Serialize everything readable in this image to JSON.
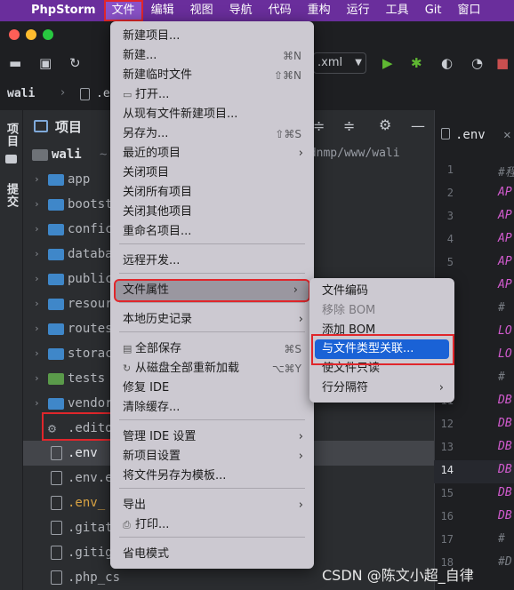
{
  "menubar": {
    "app": "PhpStorm",
    "items": [
      "文件",
      "编辑",
      "视图",
      "导航",
      "代码",
      "重构",
      "运行",
      "工具",
      "Git",
      "窗口"
    ]
  },
  "toolbar": {
    "run_config": ".xml"
  },
  "breadcrumb": {
    "project": "wali",
    "file": ".e"
  },
  "side_strip": {
    "project": "项目",
    "commit": "提交"
  },
  "project_panel": {
    "title": "项目",
    "root": "wali",
    "root_suffix": "~",
    "path": "/dnmp/www/wali",
    "rows": [
      {
        "label": "app",
        "kind": "folder"
      },
      {
        "label": "bootst",
        "kind": "folder"
      },
      {
        "label": "confic",
        "kind": "folder"
      },
      {
        "label": "databa",
        "kind": "folder"
      },
      {
        "label": "public",
        "kind": "folder"
      },
      {
        "label": "resour",
        "kind": "folder"
      },
      {
        "label": "routes",
        "kind": "folder"
      },
      {
        "label": "storac",
        "kind": "folder"
      },
      {
        "label": "tests",
        "kind": "folder-green"
      },
      {
        "label": "vendor",
        "kind": "folder"
      },
      {
        "label": ".edito",
        "kind": "gear"
      },
      {
        "label": ".env",
        "kind": "file"
      },
      {
        "label": ".env.e",
        "kind": "file"
      },
      {
        "label": ".env_",
        "kind": "file"
      },
      {
        "label": ".gitat",
        "kind": "file"
      },
      {
        "label": ".gitig",
        "kind": "file"
      },
      {
        "label": ".php_cs",
        "kind": "file"
      }
    ]
  },
  "editor": {
    "tab": ".env",
    "line_numbers": [
      "1",
      "2",
      "3",
      "4",
      "5",
      "6",
      "7",
      "8",
      "9",
      "10",
      "11",
      "12",
      "13",
      "14",
      "15",
      "16",
      "17",
      "18"
    ],
    "current_line": "14",
    "lines": [
      "#程",
      "AP",
      "AP",
      "AP",
      "AP",
      "AP",
      "#",
      "LO",
      "LO",
      "#",
      "DB",
      "DB",
      "DB",
      "DB",
      "DB",
      "DB",
      "#",
      "#D"
    ]
  },
  "file_menu": {
    "items": [
      {
        "label": "新建项目...",
        "shortcut": "",
        "arrow": false
      },
      {
        "label": "新建...",
        "shortcut": "⌘N",
        "arrow": false
      },
      {
        "label": "新建临时文件",
        "shortcut": "⇧⌘N",
        "arrow": false
      },
      {
        "label": "打开...",
        "shortcut": "",
        "arrow": false,
        "icon": "folder"
      },
      {
        "label": "从现有文件新建项目...",
        "shortcut": "",
        "arrow": false
      },
      {
        "label": "另存为...",
        "shortcut": "⇧⌘S",
        "arrow": false
      },
      {
        "label": "最近的项目",
        "shortcut": "",
        "arrow": true
      },
      {
        "label": "关闭项目",
        "shortcut": "",
        "arrow": false
      },
      {
        "label": "关闭所有项目",
        "shortcut": "",
        "arrow": false
      },
      {
        "label": "关闭其他项目",
        "shortcut": "",
        "arrow": false
      },
      {
        "label": "重命名项目...",
        "shortcut": "",
        "arrow": false
      },
      {
        "label": "远程开发...",
        "shortcut": "",
        "arrow": false
      },
      {
        "label": "文件属性",
        "shortcut": "",
        "arrow": true,
        "hover": true
      },
      {
        "label": "本地历史记录",
        "shortcut": "",
        "arrow": true
      },
      {
        "label": "全部保存",
        "shortcut": "⌘S",
        "arrow": false,
        "icon": "save"
      },
      {
        "label": "从磁盘全部重新加载",
        "shortcut": "⌥⌘Y",
        "arrow": false,
        "icon": "reload"
      },
      {
        "label": "修复 IDE",
        "shortcut": "",
        "arrow": false
      },
      {
        "label": "清除缓存...",
        "shortcut": "",
        "arrow": false
      },
      {
        "label": "管理 IDE 设置",
        "shortcut": "",
        "arrow": true
      },
      {
        "label": "新项目设置",
        "shortcut": "",
        "arrow": true
      },
      {
        "label": "将文件另存为模板...",
        "shortcut": "",
        "arrow": false
      },
      {
        "label": "导出",
        "shortcut": "",
        "arrow": true
      },
      {
        "label": "打印...",
        "shortcut": "",
        "arrow": false,
        "icon": "print"
      },
      {
        "label": "省电模式",
        "shortcut": "",
        "arrow": false
      }
    ]
  },
  "sub_menu": {
    "items": [
      {
        "label": "文件编码",
        "disabled": false
      },
      {
        "label": "移除 BOM",
        "disabled": true
      },
      {
        "label": "添加 BOM",
        "disabled": false
      },
      {
        "label": "与文件类型关联...",
        "disabled": false,
        "active": true
      },
      {
        "label": "使文件只读",
        "disabled": false
      },
      {
        "label": "行分隔符",
        "disabled": false,
        "arrow": true
      }
    ]
  },
  "watermark": "CSDN @陈文小超_自律",
  "colors": {
    "menubar": "#6a2e9c",
    "highlight": "#e0262b",
    "selection": "#1a62d6",
    "menu_bg": "#ccc9d1"
  }
}
